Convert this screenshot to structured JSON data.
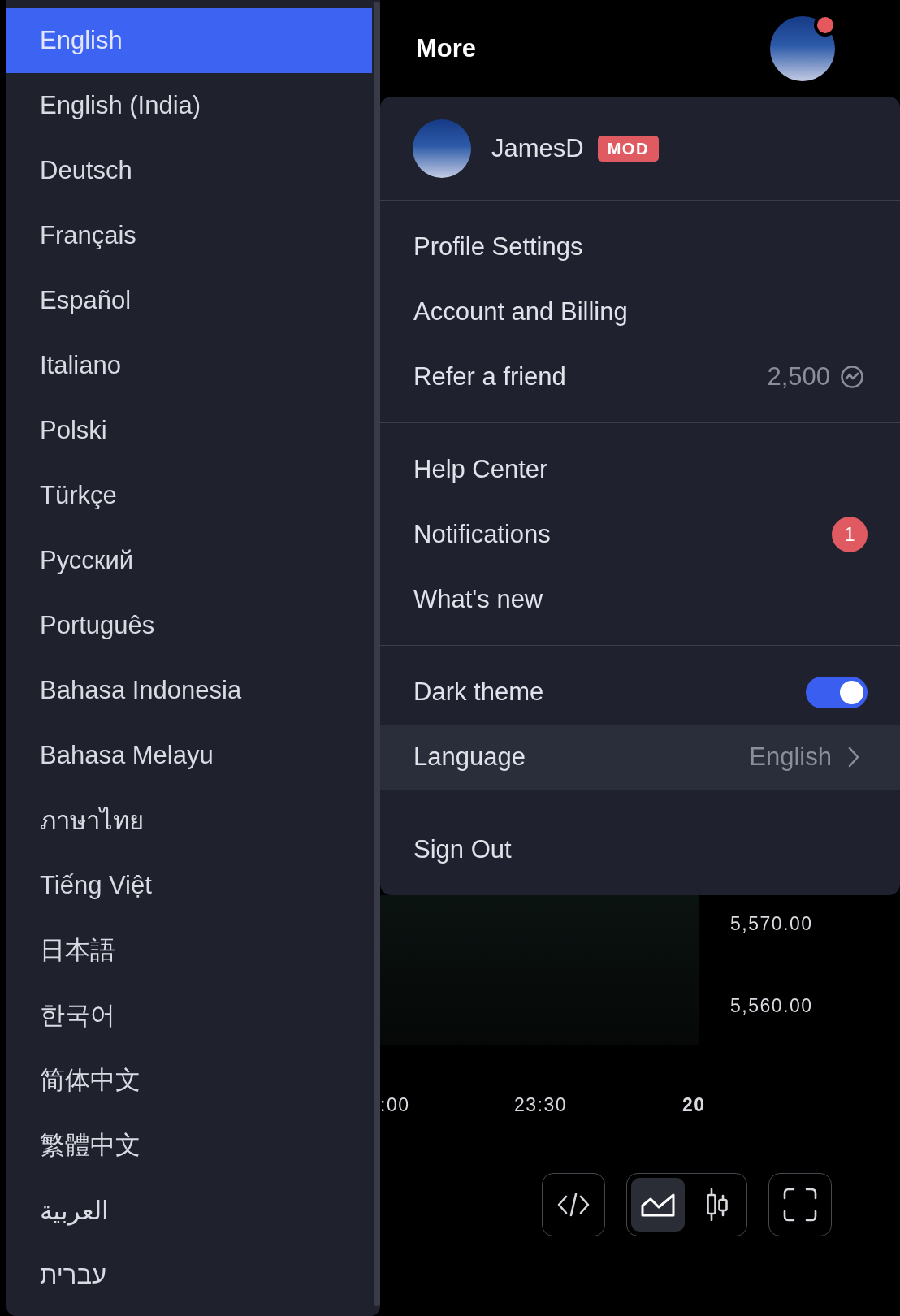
{
  "language_menu": {
    "items": [
      {
        "label": "English",
        "selected": true
      },
      {
        "label": "English (India)",
        "selected": false
      },
      {
        "label": "Deutsch",
        "selected": false
      },
      {
        "label": "Français",
        "selected": false
      },
      {
        "label": "Español",
        "selected": false
      },
      {
        "label": "Italiano",
        "selected": false
      },
      {
        "label": "Polski",
        "selected": false
      },
      {
        "label": "Türkçe",
        "selected": false
      },
      {
        "label": "Русский",
        "selected": false
      },
      {
        "label": "Português",
        "selected": false
      },
      {
        "label": "Bahasa Indonesia",
        "selected": false
      },
      {
        "label": "Bahasa Melayu",
        "selected": false
      },
      {
        "label": "ภาษาไทย",
        "selected": false
      },
      {
        "label": "Tiếng Việt",
        "selected": false
      },
      {
        "label": "日本語",
        "selected": false
      },
      {
        "label": "한국어",
        "selected": false
      },
      {
        "label": "简体中文",
        "selected": false
      },
      {
        "label": "繁體中文",
        "selected": false
      },
      {
        "label": "العربية",
        "selected": false
      },
      {
        "label": "עברית",
        "selected": false
      }
    ]
  },
  "header": {
    "title": "More",
    "avatar": {
      "notification_dot": true
    }
  },
  "account_menu": {
    "profile": {
      "name": "JamesD",
      "badge": "MOD"
    },
    "sections": [
      {
        "items": [
          {
            "kind": "link",
            "label": "Profile Settings"
          },
          {
            "kind": "link",
            "label": "Account and Billing"
          },
          {
            "kind": "reward",
            "label": "Refer a friend",
            "value": "2,500"
          }
        ]
      },
      {
        "items": [
          {
            "kind": "link",
            "label": "Help Center"
          },
          {
            "kind": "count",
            "label": "Notifications",
            "count": "1"
          },
          {
            "kind": "link",
            "label": "What's new"
          }
        ]
      },
      {
        "items": [
          {
            "kind": "toggle",
            "label": "Dark theme",
            "on": true
          },
          {
            "kind": "submenu",
            "label": "Language",
            "value": "English",
            "expanded": true
          }
        ]
      },
      {
        "items": [
          {
            "kind": "link",
            "label": "Sign Out"
          }
        ]
      }
    ]
  },
  "chart": {
    "price_labels": [
      "5,570.00",
      "5,560.00"
    ],
    "time_labels": [
      {
        "kind": "time",
        "label": ":00"
      },
      {
        "kind": "time",
        "label": "23:30"
      },
      {
        "kind": "day",
        "label": "20"
      }
    ]
  },
  "toolbar": {
    "buttons": [
      {
        "kind": "embed"
      },
      {
        "kind": "group",
        "options": [
          {
            "kind": "area",
            "selected": true
          },
          {
            "kind": "candles",
            "selected": false
          }
        ]
      },
      {
        "kind": "fullscreen"
      }
    ]
  }
}
